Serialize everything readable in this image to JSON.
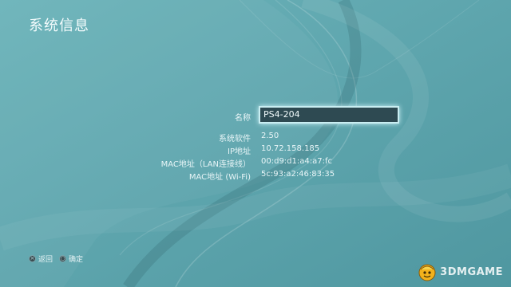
{
  "screen": {
    "title": "系统信息"
  },
  "info": {
    "name_label": "名称",
    "name_value": "PS4-204",
    "rows": [
      {
        "label": "系统软件",
        "value": "2.50"
      },
      {
        "label": "IP地址",
        "value": "10.72.158.185"
      },
      {
        "label": "MAC地址（LAN连接线）",
        "value": "00:d9:d1:a4:a7:fc"
      },
      {
        "label": "MAC地址 (Wi-Fi)",
        "value": "5c:93:a2:46:83:35"
      }
    ]
  },
  "footer": {
    "back_label": "返回",
    "confirm_label": "确定"
  },
  "watermark": {
    "text": "3DMGAME"
  },
  "colors": {
    "background": "#5aa3ab",
    "field_bg": "#2e4a52",
    "text": "#e8f5f7"
  }
}
